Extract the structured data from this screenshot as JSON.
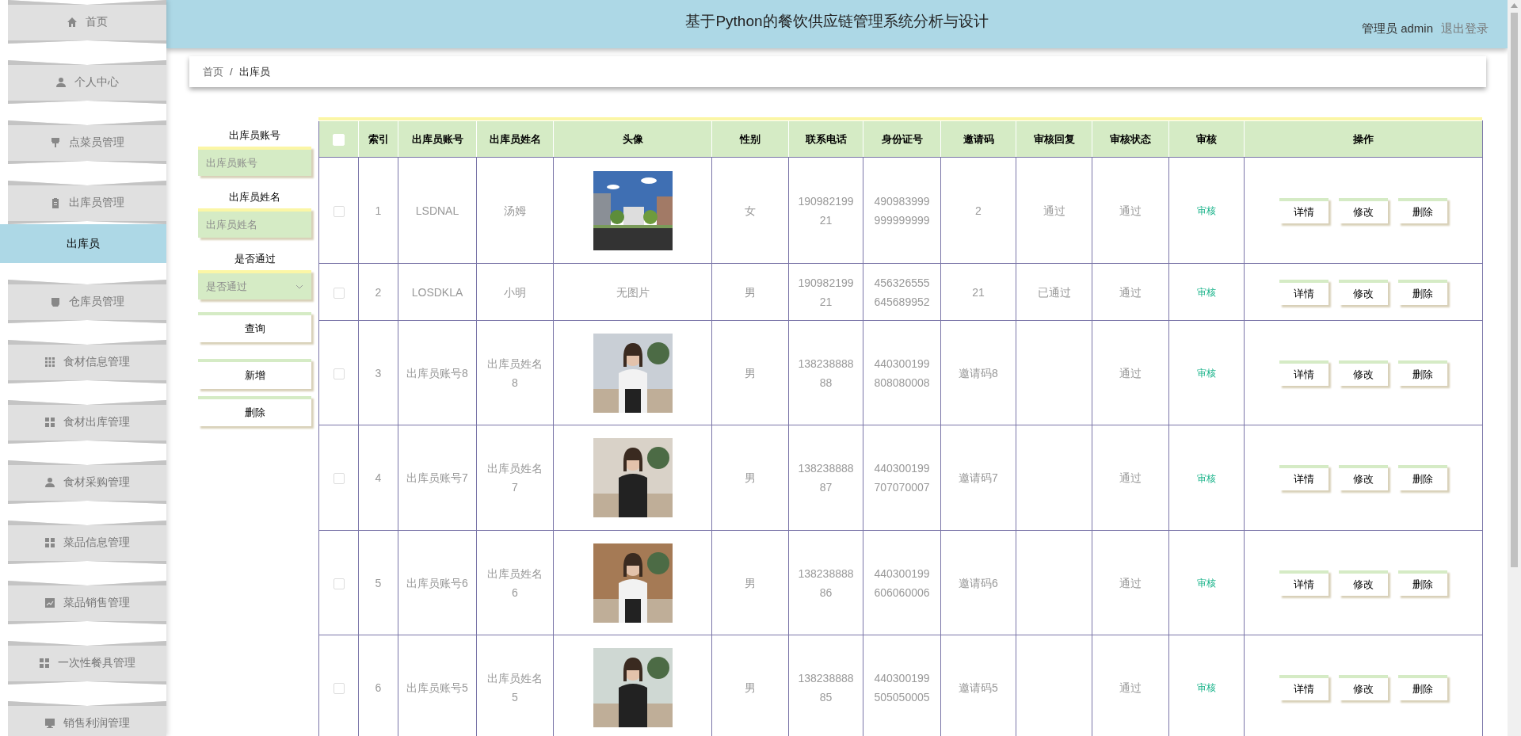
{
  "sidebar": {
    "items": [
      {
        "label": "首页",
        "selected": false
      },
      {
        "label": "个人中心",
        "selected": false
      },
      {
        "label": "点菜员管理",
        "selected": false
      },
      {
        "label": "出库员管理",
        "selected": false,
        "children": [
          {
            "label": "出库员",
            "selected": true
          }
        ]
      },
      {
        "label": "仓库员管理",
        "selected": false
      },
      {
        "label": "食材信息管理",
        "selected": false
      },
      {
        "label": "食材出库管理",
        "selected": false
      },
      {
        "label": "食材采购管理",
        "selected": false
      },
      {
        "label": "菜品信息管理",
        "selected": false
      },
      {
        "label": "菜品销售管理",
        "selected": false
      },
      {
        "label": "一次性餐具管理",
        "selected": false
      },
      {
        "label": "销售利润管理",
        "selected": false
      }
    ]
  },
  "header": {
    "title": "基于Python的餐饮供应链管理系统分析与设计",
    "user": "管理员 admin",
    "logout": "退出登录"
  },
  "breadcrumb": [
    "首页",
    "出库员"
  ],
  "breadcrumb_separator": "/",
  "filters": [
    {
      "kind": "input",
      "label": "出库员账号",
      "placeholder": "出库员账号"
    },
    {
      "kind": "input",
      "label": "出库员姓名",
      "placeholder": "出库员姓名"
    },
    {
      "kind": "select",
      "label": "是否通过",
      "placeholder": "是否通过"
    }
  ],
  "filter_buttons": [
    "查询",
    "新增",
    "删除"
  ],
  "table": {
    "header_checked": false,
    "columns": [
      "索引",
      "出库员账号",
      "出库员姓名",
      "头像",
      "性别",
      "联系电话",
      "身份证号",
      "邀请码",
      "审核回复",
      "审核状态",
      "审核",
      "操作"
    ],
    "rows": [
      {
        "checked": false,
        "index": "1",
        "account": "LSDNAL",
        "name": "汤姆",
        "gender": "女",
        "phone": "19098219921",
        "id_number": "490983999999999999",
        "invite": "2",
        "reply": "通过",
        "status": "通过",
        "audit": "审核",
        "actions": [
          "详情",
          "修改",
          "删除"
        ]
      },
      {
        "checked": false,
        "index": "2",
        "account": "LOSDKLA",
        "name": "小明",
        "avatar": {
          "kind": "text",
          "text": "无图片"
        },
        "gender": "男",
        "phone": "19098219921",
        "id_number": "456326555645689952",
        "invite": "21",
        "reply": "已通过",
        "status": "通过",
        "audit": "审核",
        "actions": [
          "详情",
          "修改",
          "删除"
        ]
      },
      {
        "checked": false,
        "index": "3",
        "account": "出库员账号8",
        "name": "出库员姓名8",
        "gender": "男",
        "phone": "13823888888",
        "id_number": "440300199808080008",
        "invite": "邀请码8",
        "status": "通过",
        "audit": "审核",
        "actions": [
          "详情",
          "修改",
          "删除"
        ]
      },
      {
        "checked": false,
        "index": "4",
        "account": "出库员账号7",
        "name": "出库员姓名7",
        "gender": "男",
        "phone": "13823888887",
        "id_number": "440300199707070007",
        "invite": "邀请码7",
        "status": "通过",
        "audit": "审核",
        "actions": [
          "详情",
          "修改",
          "删除"
        ]
      },
      {
        "checked": false,
        "index": "5",
        "account": "出库员账号6",
        "name": "出库员姓名6",
        "gender": "男",
        "phone": "13823888886",
        "id_number": "440300199606060006",
        "invite": "邀请码6",
        "status": "通过",
        "audit": "审核",
        "actions": [
          "详情",
          "修改",
          "删除"
        ]
      },
      {
        "checked": false,
        "index": "6",
        "account": "出库员账号5",
        "name": "出库员姓名5",
        "gender": "男",
        "phone": "13823888885",
        "id_number": "440300199505050005",
        "invite": "邀请码5",
        "status": "通过",
        "audit": "审核",
        "actions": [
          "详情",
          "修改",
          "删除"
        ]
      }
    ]
  }
}
